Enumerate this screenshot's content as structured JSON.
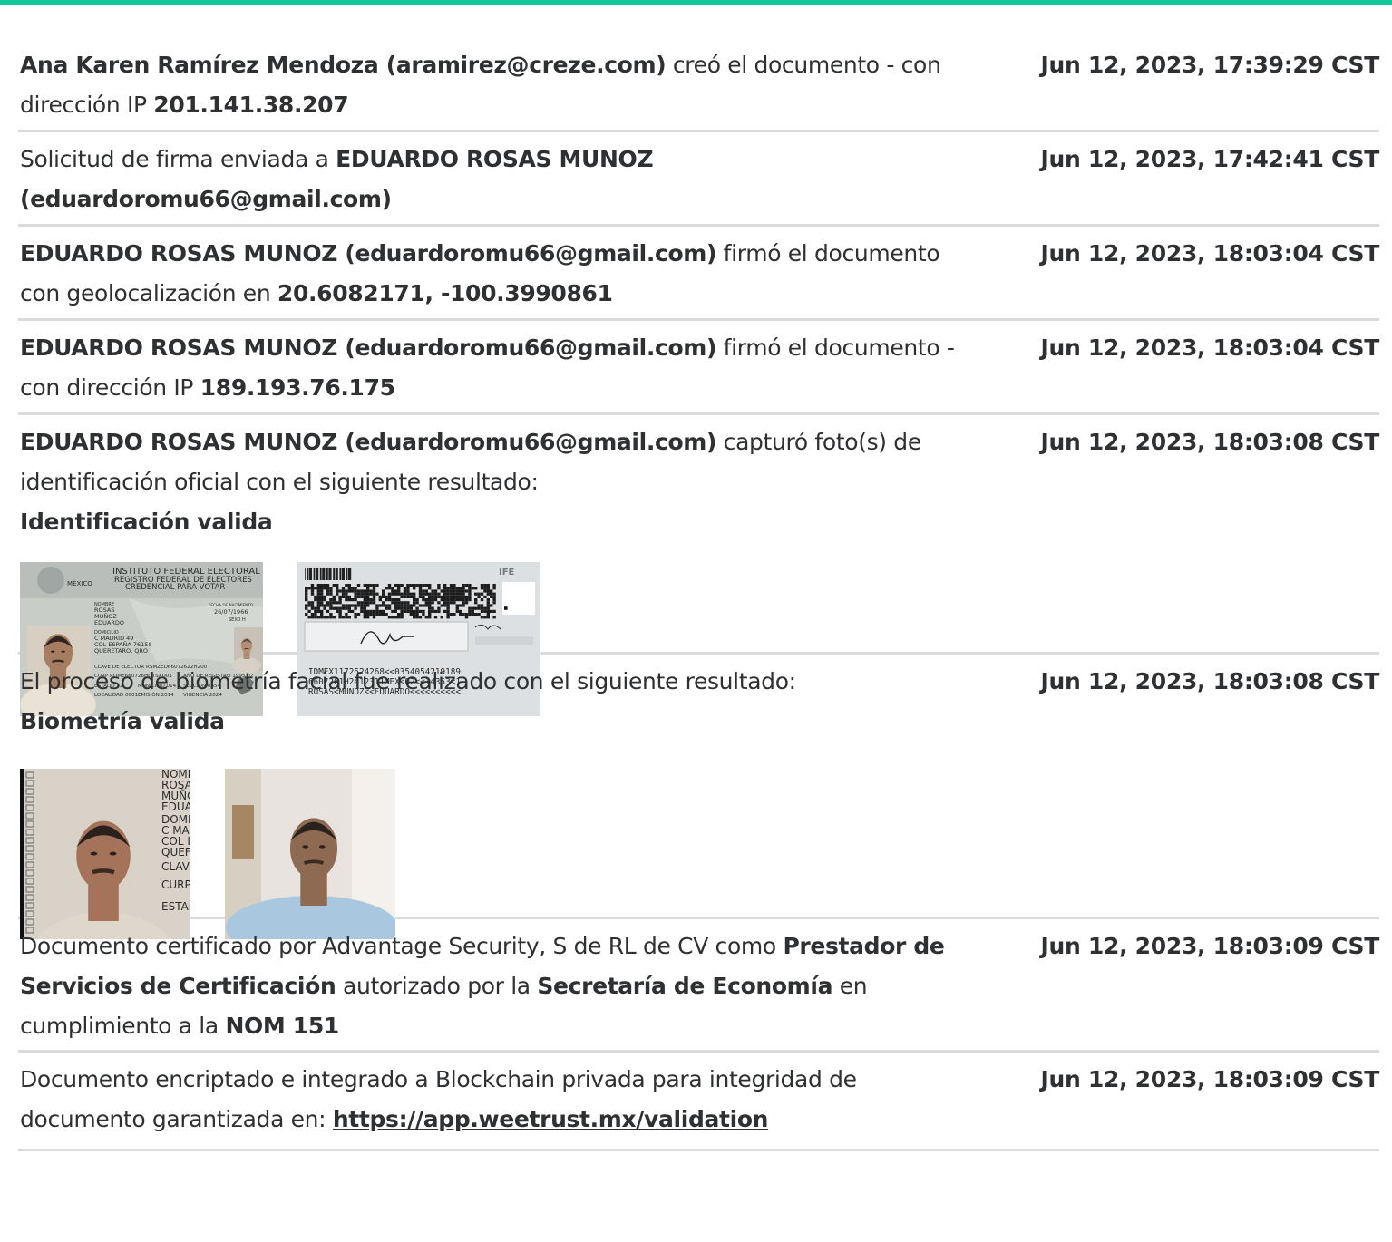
{
  "entries": [
    {
      "parts": [
        {
          "t": "Ana Karen Ramírez Mendoza (aramirez@creze.com)",
          "b": true
        },
        {
          "t": " creó el documento - con dirección IP "
        },
        {
          "t": "201.141.38.207",
          "b": true
        }
      ],
      "timestamp": "Jun 12, 2023, 17:39:29 CST"
    },
    {
      "parts": [
        {
          "t": "Solicitud de firma enviada a "
        },
        {
          "t": "EDUARDO ROSAS MUNOZ (eduardoromu66@gmail.com)",
          "b": true
        }
      ],
      "timestamp": "Jun 12, 2023, 17:42:41 CST"
    },
    {
      "parts": [
        {
          "t": "EDUARDO ROSAS MUNOZ (eduardoromu66@gmail.com)",
          "b": true
        },
        {
          "t": " firmó el documento con geolocalización en "
        },
        {
          "t": "20.6082171, -100.3990861",
          "b": true
        }
      ],
      "timestamp": "Jun 12, 2023, 18:03:04 CST"
    },
    {
      "parts": [
        {
          "t": "EDUARDO ROSAS MUNOZ (eduardoromu66@gmail.com)",
          "b": true
        },
        {
          "t": " firmó el documento - con dirección IP "
        },
        {
          "t": "189.193.76.175",
          "b": true
        }
      ],
      "timestamp": "Jun 12, 2023, 18:03:04 CST"
    },
    {
      "parts": [
        {
          "t": "EDUARDO ROSAS MUNOZ (eduardoromu66@gmail.com)",
          "b": true
        },
        {
          "t": " capturó foto(s) de identificación oficial con el siguiente resultado:"
        },
        {
          "br": true
        },
        {
          "t": "Identificación valida",
          "b": true
        }
      ],
      "timestamp": "Jun 12, 2023, 18:03:08 CST",
      "images": [
        "id-front",
        "id-back"
      ]
    },
    {
      "parts": [
        {
          "t": "El proceso de biometría facial fue realizado con el siguiente resultado:"
        },
        {
          "br": true
        },
        {
          "t": "Biometría valida",
          "b": true
        }
      ],
      "timestamp": "Jun 12, 2023, 18:03:08 CST",
      "images": [
        "face-id-crop",
        "face-selfie"
      ]
    },
    {
      "parts": [
        {
          "t": "Documento certificado por Advantage Security, S de RL de CV como "
        },
        {
          "t": "Prestador de Servicios de Certificación",
          "b": true
        },
        {
          "t": " autorizado por la "
        },
        {
          "t": "Secretaría de Economía",
          "b": true
        },
        {
          "t": " en cumplimiento a la "
        },
        {
          "t": "NOM 151",
          "b": true
        }
      ],
      "timestamp": "Jun 12, 2023, 18:03:09 CST"
    },
    {
      "parts": [
        {
          "t": "Documento encriptado e integrado a Blockchain privada para integridad de documento garantizada en: "
        },
        {
          "t": "https://app.weetrust.mx/validation",
          "b": true,
          "link": true
        }
      ],
      "timestamp": "Jun 12, 2023, 18:03:09 CST"
    }
  ],
  "id_card_front": {
    "institute": "INSTITUTO FEDERAL ELECTORAL",
    "registry": "REGISTRO FEDERAL DE ELECTORES",
    "credential": "CREDENCIAL PARA VOTAR",
    "country": "MÉXICO",
    "name_label": "NOMBRE",
    "name_lines": [
      "ROSAS",
      "MUÑOZ",
      "EDUARDO"
    ],
    "address_label": "DOMICILIO",
    "address_lines": [
      "C MADRID 49",
      "COL ESPAÑA 76158",
      "QUERETARO, QRO"
    ],
    "dob_label": "FECHA DE NACIMIENTO",
    "dob": "26/07/1966",
    "sex": "SEXO  H",
    "elector_key": "CLAVE DE ELECTOR  RSMZED66072622H200",
    "curp": "CURP  ROME660726HQTSXD01",
    "registro": "AÑO DE REGISTRO  1995 02",
    "estado": "ESTADO  22",
    "municipio": "MUNICIPIO  014",
    "seccion": "SECCIÓN  0354",
    "localidad": "LOCALIDAD  0001",
    "emision": "EMISIÓN  2014",
    "vigencia": "VIGENCIA  2024"
  },
  "id_card_back": {
    "ife": "IFE",
    "mrz": [
      "IDMEX1172524268<<0354054219189",
      "6607261H2412311MEX<02<<14353<1",
      "ROSAS<MUNOZ<<EDUARDO<<<<<<<<<<"
    ]
  },
  "id_crop": {
    "lines": [
      "NOMB",
      "ROSA",
      "MUÑC",
      "EDUA",
      "DOMIC",
      "C MA",
      "COL I",
      "QUEF",
      "CLAVE",
      "CURP",
      "ESTAD"
    ]
  },
  "colors": {
    "accent": "#12c99a",
    "divider": "#d9dadc",
    "text": "#2f3032"
  }
}
